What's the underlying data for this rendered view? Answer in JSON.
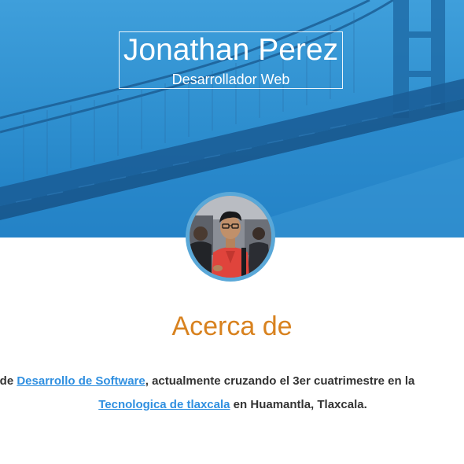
{
  "header": {
    "name": "Jonathan Perez",
    "role": "Desarrollador Web"
  },
  "profile": {
    "avatar_icon": "profile-photo"
  },
  "about": {
    "title": "Acerca de",
    "line1_prefix": "nte de ",
    "line1_link": "Desarrollo de Software",
    "line1_suffix": ", actualmente cruzando el 3er cuatrimestre en la",
    "line2_link": "Tecnologica de tlaxcala",
    "line2_suffix": " en Huamantla, Tlaxcala."
  },
  "colors": {
    "hero_blue": "#2d8fd0",
    "accent_orange": "#d8821f",
    "link_blue": "#2f8fe0"
  }
}
